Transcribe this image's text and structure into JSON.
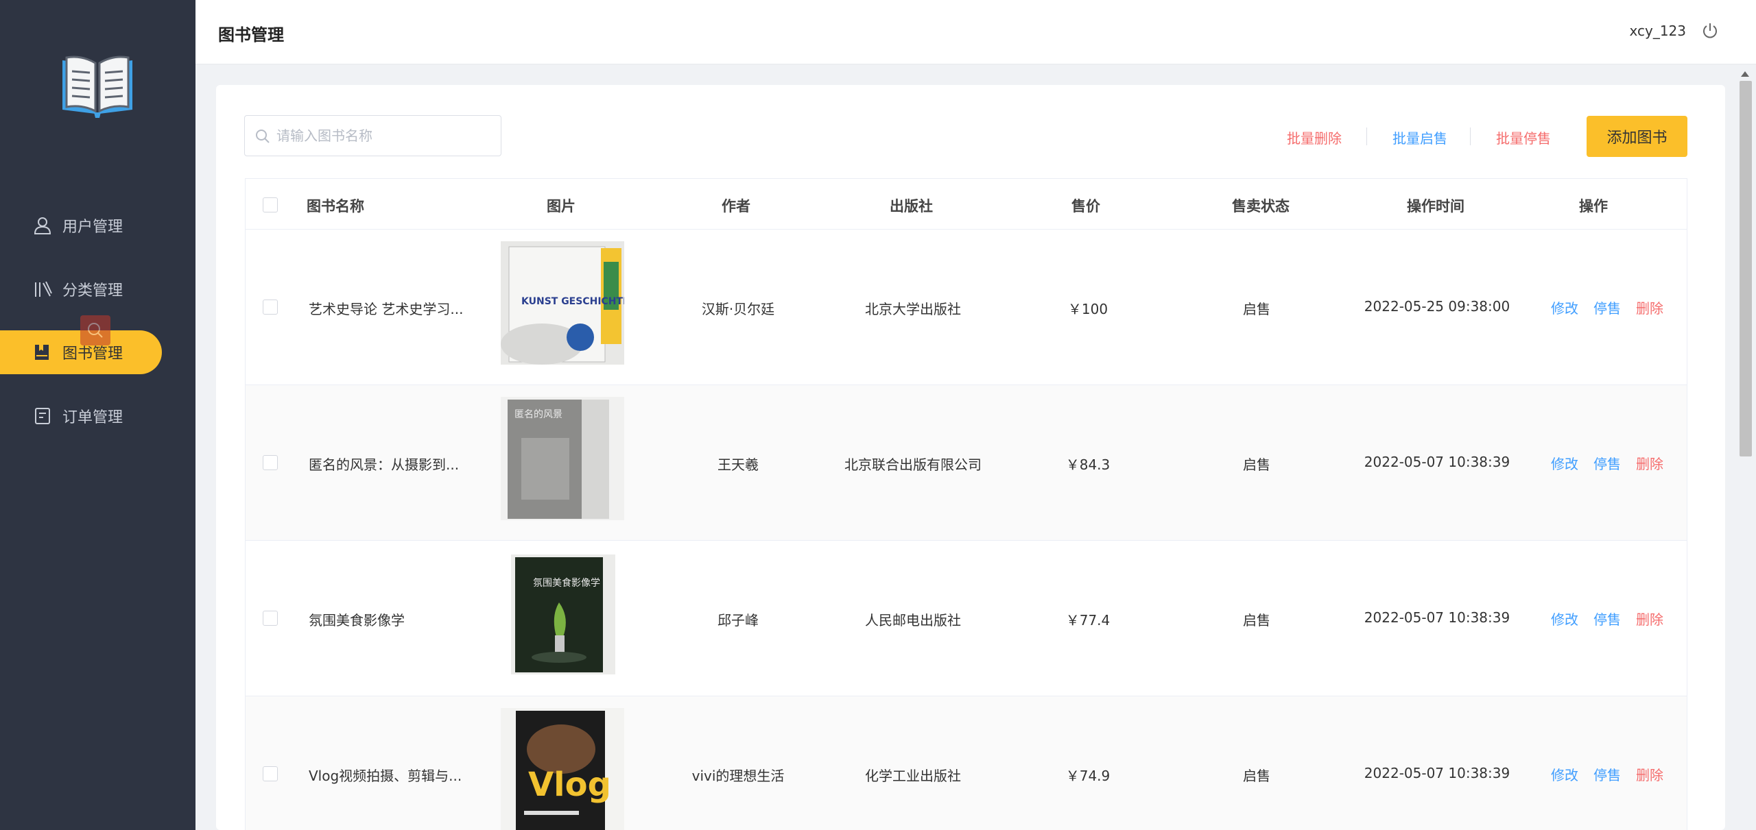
{
  "sidebar": {
    "items": [
      {
        "label": "用户管理",
        "icon": "user-icon"
      },
      {
        "label": "分类管理",
        "icon": "library-icon"
      },
      {
        "label": "图书管理",
        "icon": "book-icon"
      },
      {
        "label": "订单管理",
        "icon": "order-icon"
      }
    ],
    "active_index": 2
  },
  "header": {
    "title": "图书管理",
    "username": "xcy_123",
    "logout_icon": "power-icon"
  },
  "toolbar": {
    "search_placeholder": "请输入图书名称",
    "batch_delete": "批量删除",
    "batch_enable": "批量启售",
    "batch_disable": "批量停售",
    "add_book": "添加图书"
  },
  "table": {
    "columns": [
      "图书名称",
      "图片",
      "作者",
      "出版社",
      "售价",
      "售卖状态",
      "操作时间",
      "操作"
    ],
    "rows": [
      {
        "name": "艺术史导论 艺术史学习...",
        "author": "汉斯·贝尔廷",
        "publisher": "北京大学出版社",
        "price": "￥100",
        "status": "启售",
        "time": "2022-05-25 09:38:00",
        "cover": "KUNST GESCHICHTE"
      },
      {
        "name": "匿名的风景：从摄影到...",
        "author": "王天羲",
        "publisher": "北京联合出版有限公司",
        "price": "￥84.3",
        "status": "启售",
        "time": "2022-05-07 10:38:39",
        "cover": "匿名的风景"
      },
      {
        "name": "氛围美食影像学",
        "author": "邱子峰",
        "publisher": "人民邮电出版社",
        "price": "￥77.4",
        "status": "启售",
        "time": "2022-05-07 10:38:39",
        "cover": "氛围美食影像学"
      },
      {
        "name": "Vlog视频拍摄、剪辑与...",
        "author": "vivi的理想生活",
        "publisher": "化学工业出版社",
        "price": "￥74.9",
        "status": "启售",
        "time": "2022-05-07 10:38:39",
        "cover": "Vlog"
      }
    ],
    "actions": {
      "edit": "修改",
      "disable": "停售",
      "delete": "删除"
    }
  },
  "colors": {
    "sidebar_bg": "#2e3442",
    "accent": "#fbbf2a",
    "link_blue": "#409eff",
    "danger_red": "#f56c6c"
  }
}
